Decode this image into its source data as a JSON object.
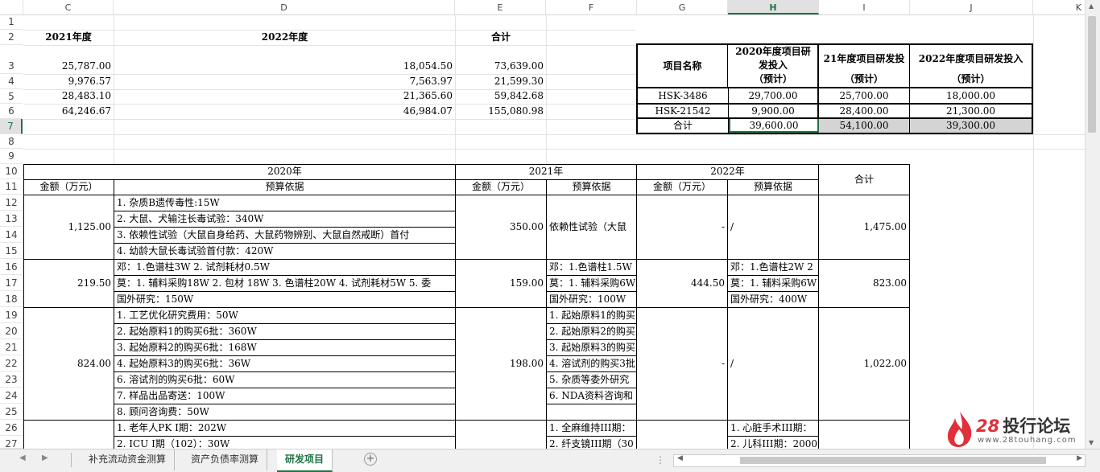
{
  "columns": [
    "C",
    "D",
    "E",
    "F",
    "G",
    "H",
    "I",
    "J",
    "K"
  ],
  "selected_column": "H",
  "rows": [
    "1",
    "2",
    "3",
    "4",
    "5",
    "6",
    "7",
    "8",
    "9",
    "10",
    "11",
    "12",
    "13",
    "14",
    "15",
    "16",
    "17",
    "18",
    "19",
    "20",
    "21",
    "22",
    "23",
    "24",
    "25",
    "26",
    "27"
  ],
  "selected_row": "7",
  "top": {
    "h2021": "2021年度",
    "h2022": "2022年度",
    "htotal": "合计",
    "r3": [
      "25,787.00",
      "18,054.50",
      "73,639.00"
    ],
    "r4": [
      "9,976.57",
      "7,563.97",
      "21,599.30"
    ],
    "r5": [
      "28,483.10",
      "21,365.60",
      "59,842.68"
    ],
    "r6": [
      "64,246.67",
      "46,984.07",
      "155,080.98"
    ]
  },
  "box": {
    "name": "项目名称",
    "h2020a": "2020年度项目研",
    "h2020b": "发投入",
    "h2020c": "（预计）",
    "h2021a": "21年度项目研发投",
    "h2021c": "（预计）",
    "h2022a": "2022年度项目研发投入",
    "h2022c": "（预计）",
    "rows": [
      [
        "HSK-3486",
        "29,700.00",
        "25,700.00",
        "18,000.00"
      ],
      [
        "HSK-21542",
        "9,900.00",
        "28,400.00",
        "21,300.00"
      ],
      [
        "合计",
        "39,600.00",
        "54,100.00",
        "39,300.00"
      ]
    ]
  },
  "budget": {
    "y2020": "2020年",
    "y2021": "2021年",
    "y2022": "2022年",
    "total": "合计",
    "amt": "金额（万元）",
    "basis": "预算依据",
    "g1": {
      "a2020": "1,125.00",
      "a2021": "350.00",
      "a2022": "-",
      "b2022": "/",
      "t": "1,475.00",
      "items": [
        "1. 杂质B遗传毒性:15W",
        "2. 大鼠、犬输注长毒试验：340W",
        "3. 依赖性试验（大鼠自身给药、大鼠药物辨别、大鼠自然戒断）首付",
        "4. 幼龄大鼠长毒试验首付款：420W"
      ],
      "b2021": "依赖性试验（大鼠"
    },
    "g2": {
      "a2020": "219.50",
      "a2021": "159.00",
      "a2022": "444.50",
      "t": "823.00",
      "items": [
        "邓：1.色谱柱3W 2. 试剂耗材0.5W",
        "莫：1. 辅料采购18W 2. 包材 18W 3. 色谱柱20W 4. 试剂耗材5W 5. 委",
        "国外研究：150W"
      ],
      "items2021": [
        "邓：1.色谱柱1.5W",
        "莫：1. 辅料采购6W",
        "国外研究：100W"
      ],
      "items2022": [
        "邓：1.色谱柱2W 2",
        "莫：1. 辅料采购6W",
        "国外研究：400W"
      ]
    },
    "g3": {
      "a2020": "824.00",
      "a2021": "198.00",
      "a2022": "-",
      "b2022": "/",
      "t": "1,022.00",
      "items": [
        "1. 工艺优化研究费用：50W",
        "2. 起始原料1的购买6批：360W",
        "3. 起始原料2的购买6批：168W",
        "4. 起始原料3的购买6批：36W",
        "6. 溶试剂的购买6批：60W",
        "7. 样品出品寄送：100W",
        "8. 顾问咨询费：50W"
      ],
      "items2021": [
        "1. 起始原料1的购买",
        "2. 起始原料2的购买",
        "3. 起始原料3的购买",
        "4. 溶试剂的购买3批",
        "5. 杂质等委外研究",
        "6. NDA资料咨询和"
      ]
    },
    "g4": {
      "items": [
        "1. 老年人PK I期：202W",
        "2. ICU I期（102）：30W"
      ],
      "items2021": [
        "1. 全麻维持III期：",
        "2. 纤支镜III期（30"
      ],
      "items2022": [
        "1. 心脏手术III期：",
        "2. 儿科III期：2000"
      ]
    }
  },
  "tabs": [
    "补充流动资金测算",
    "资产负债率测算",
    "研发项目"
  ],
  "active_tab": "研发项目",
  "logo": {
    "number": "28",
    "name": "投行论坛",
    "url": "www.28touhang.com"
  }
}
